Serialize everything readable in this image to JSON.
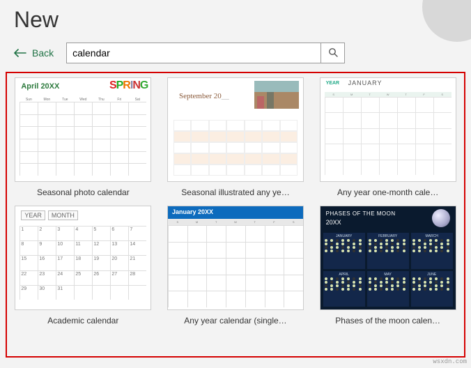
{
  "header": {
    "title": "New"
  },
  "nav": {
    "back_label": "Back"
  },
  "search": {
    "value": "calendar"
  },
  "templates": [
    {
      "label": "Seasonal photo calendar",
      "preview": {
        "title": "April 20XX",
        "art": "SPRING"
      }
    },
    {
      "label": "Seasonal illustrated any ye…",
      "preview": {
        "title": "September 20"
      }
    },
    {
      "label": "Any year one-month cale…",
      "preview": {
        "year": "YEAR",
        "month": "JANUARY"
      }
    },
    {
      "label": "Academic calendar",
      "preview": {
        "year": "YEAR",
        "month": "MONTH"
      }
    },
    {
      "label": "Any year calendar (single…",
      "preview": {
        "title": "January 20XX"
      }
    },
    {
      "label": "Phases of the moon calen…",
      "preview": {
        "title": "PHASES OF THE MOON",
        "year": "20XX",
        "months": [
          "JANUARY",
          "FEBRUARY",
          "MARCH",
          "APRIL",
          "MAY",
          "JUNE"
        ]
      }
    }
  ],
  "days_short": [
    "Sunday",
    "Monday",
    "Tuesday",
    "Wednesday",
    "Thursday",
    "Friday",
    "Saturday"
  ],
  "watermark": "wsxdn.com"
}
